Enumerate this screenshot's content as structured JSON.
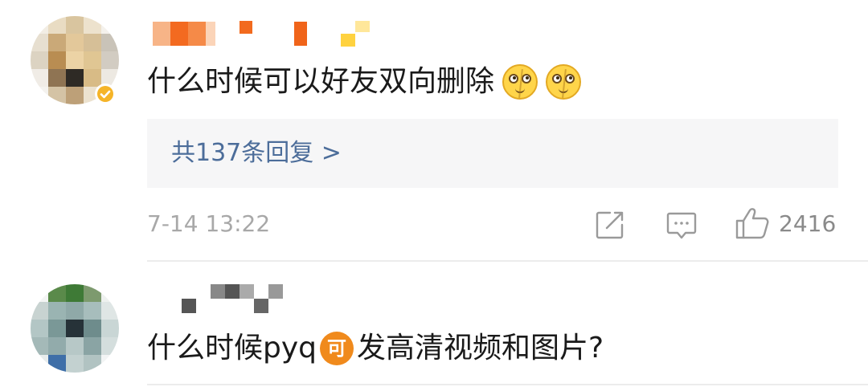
{
  "comments": [
    {
      "text": "什么时候可以好友双向删除",
      "emojis": [
        "crying-laugh-emoji",
        "crying-laugh-emoji"
      ],
      "replies_label": "共137条回复 >",
      "timestamp": "7-14 13:22",
      "like_count": "2416",
      "avatar_verified": true
    },
    {
      "text_before": "什么时候pyq",
      "badge": "可",
      "text_after": "发高清视频和图片?"
    }
  ],
  "colors": {
    "link": "#4c6d9a",
    "meta": "#a8a8a8",
    "reply_box_bg": "#f6f6f7",
    "badge_orange": "#f08a1c"
  }
}
